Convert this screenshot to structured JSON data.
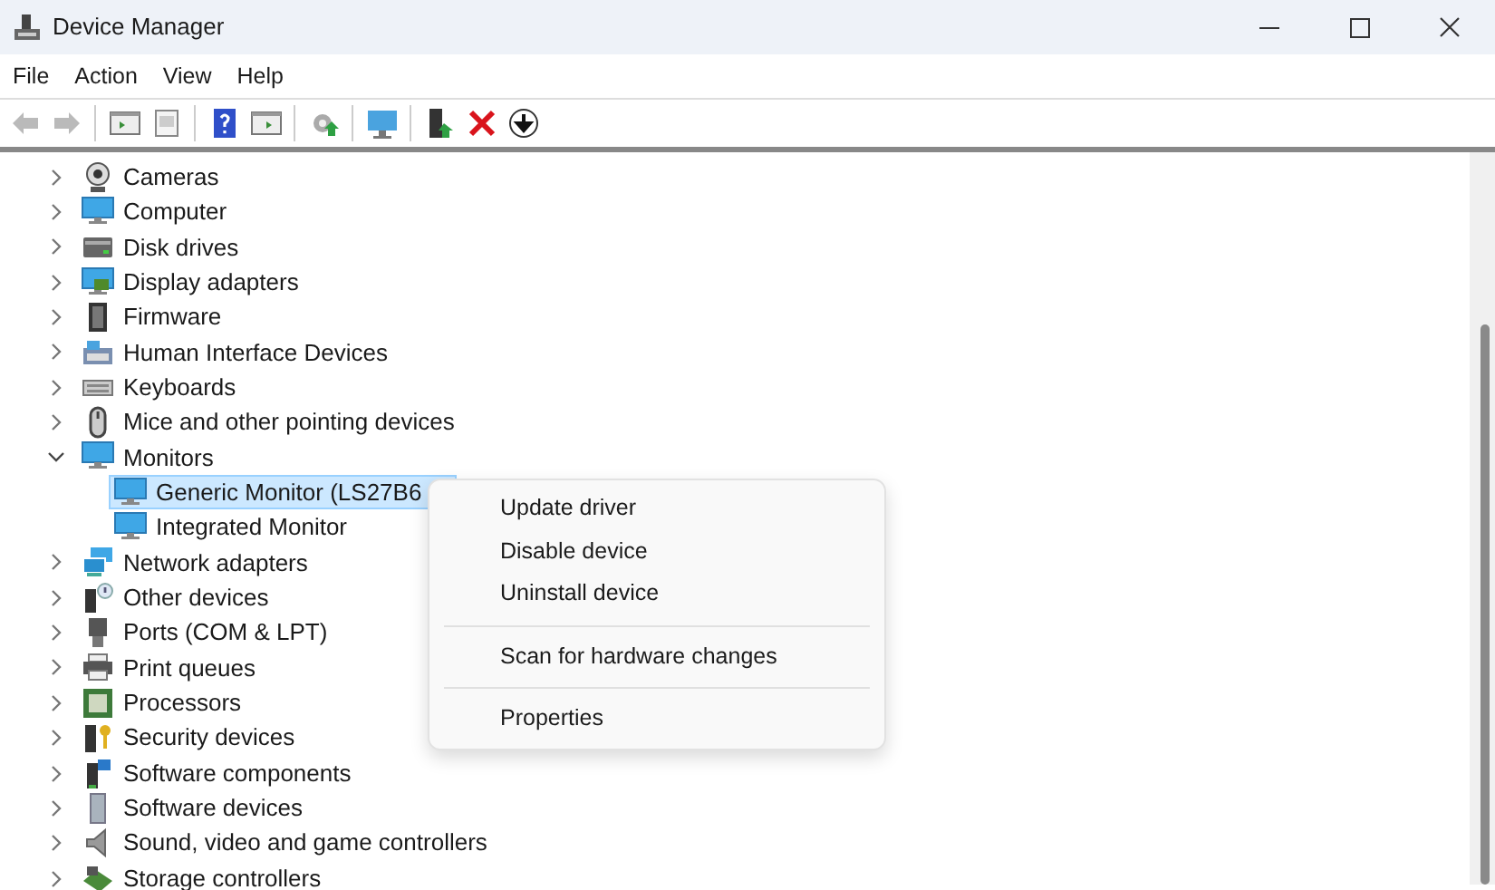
{
  "window": {
    "title": "Device Manager"
  },
  "menu": [
    "File",
    "Action",
    "View",
    "Help"
  ],
  "toolbar": [
    {
      "disabled": true
    },
    {
      "disabled": true
    },
    {
      "disabled": false
    },
    {
      "disabled": false
    },
    {
      "disabled": false
    },
    {
      "disabled": false
    },
    {
      "disabled": false
    },
    {
      "disabled": false
    },
    {
      "disabled": false
    },
    {
      "disabled": false
    },
    {
      "disabled": false
    }
  ],
  "tree": [
    {
      "label": "Cameras",
      "expanded": false,
      "selected": false
    },
    {
      "label": "Computer",
      "expanded": false,
      "selected": false
    },
    {
      "label": "Disk drives",
      "expanded": false,
      "selected": false
    },
    {
      "label": "Display adapters",
      "expanded": false,
      "selected": false
    },
    {
      "label": "Firmware",
      "expanded": false,
      "selected": false
    },
    {
      "label": "Human Interface Devices",
      "expanded": false,
      "selected": false
    },
    {
      "label": "Keyboards",
      "expanded": false,
      "selected": false
    },
    {
      "label": "Mice and other pointing devices",
      "expanded": false,
      "selected": false
    },
    {
      "label": "Monitors",
      "expanded": true,
      "selected": false,
      "children": [
        {
          "label": "Generic Monitor (LS27B6",
          "selected": true
        },
        {
          "label": "Integrated Monitor",
          "selected": false
        }
      ]
    },
    {
      "label": "Network adapters",
      "expanded": false,
      "selected": false
    },
    {
      "label": "Other devices",
      "expanded": false,
      "selected": false
    },
    {
      "label": "Ports (COM & LPT)",
      "expanded": false,
      "selected": false
    },
    {
      "label": "Print queues",
      "expanded": false,
      "selected": false
    },
    {
      "label": "Processors",
      "expanded": false,
      "selected": false
    },
    {
      "label": "Security devices",
      "expanded": false,
      "selected": false
    },
    {
      "label": "Software components",
      "expanded": false,
      "selected": false
    },
    {
      "label": "Software devices",
      "expanded": false,
      "selected": false
    },
    {
      "label": "Sound, video and game controllers",
      "expanded": false,
      "selected": false
    },
    {
      "label": "Storage controllers",
      "expanded": false,
      "selected": false
    }
  ],
  "context_menu": [
    {
      "kind": "item",
      "label": "Update driver"
    },
    {
      "kind": "item",
      "label": "Disable device"
    },
    {
      "kind": "item",
      "label": "Uninstall device"
    },
    {
      "kind": "separator"
    },
    {
      "kind": "item",
      "label": "Scan for hardware changes"
    },
    {
      "kind": "separator"
    },
    {
      "kind": "item",
      "label": "Properties"
    }
  ]
}
